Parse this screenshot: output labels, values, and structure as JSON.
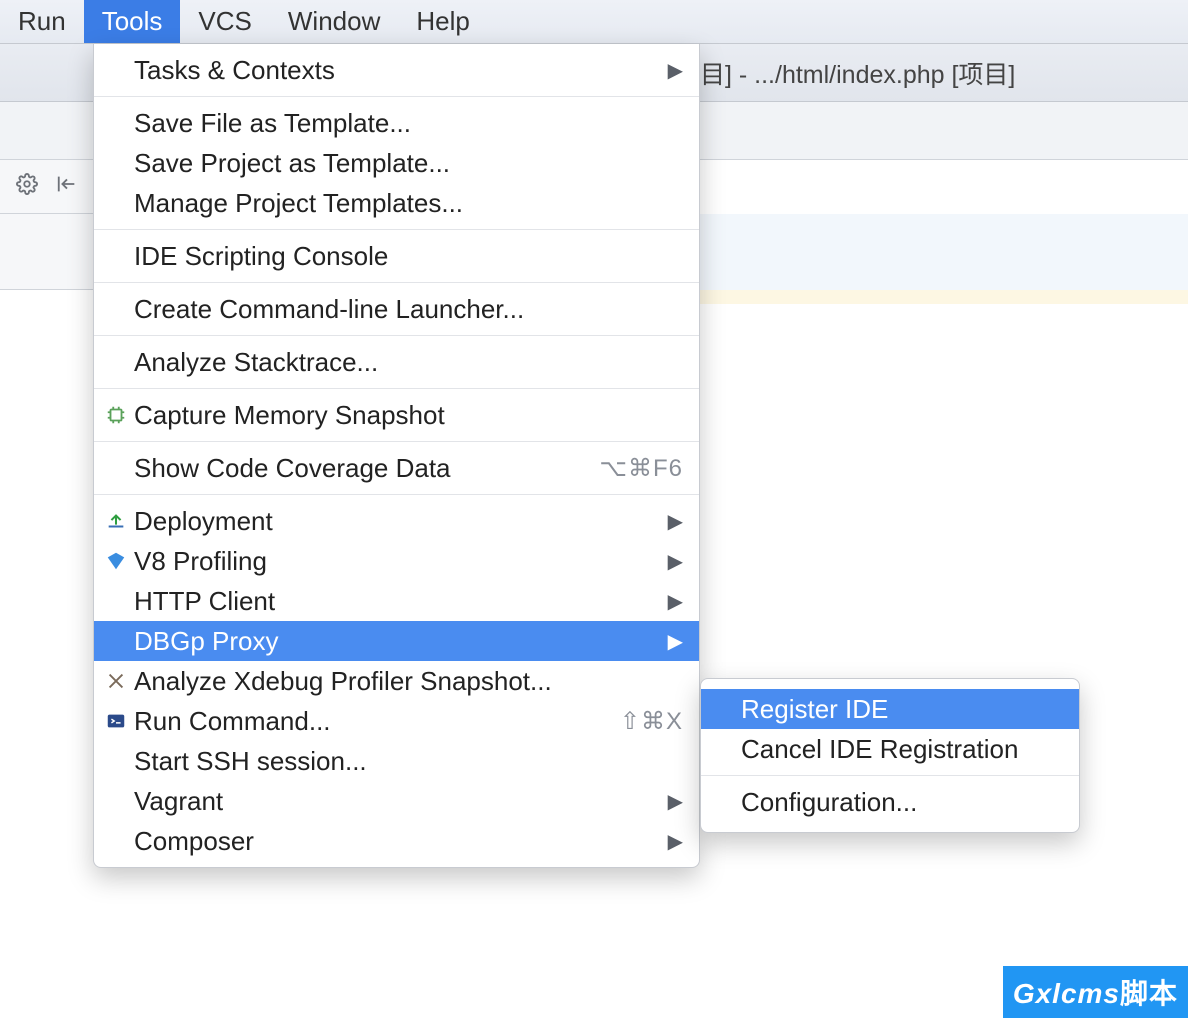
{
  "menubar": {
    "items": [
      {
        "label": "Run"
      },
      {
        "label": "Tools"
      },
      {
        "label": "VCS"
      },
      {
        "label": "Window"
      },
      {
        "label": "Help"
      }
    ],
    "active_index": 1
  },
  "title": "目] - .../html/index.php [项目]",
  "tools_menu": {
    "groups": [
      [
        {
          "label": "Tasks & Contexts",
          "submenu": true
        }
      ],
      [
        {
          "label": "Save File as Template..."
        },
        {
          "label": "Save Project as Template..."
        },
        {
          "label": "Manage Project Templates..."
        }
      ],
      [
        {
          "label": "IDE Scripting Console"
        }
      ],
      [
        {
          "label": "Create Command-line Launcher..."
        }
      ],
      [
        {
          "label": "Analyze Stacktrace..."
        }
      ],
      [
        {
          "label": "Capture Memory Snapshot",
          "icon": "chip-icon"
        }
      ],
      [
        {
          "label": "Show Code Coverage Data",
          "shortcut": "⌥⌘F6"
        }
      ],
      [
        {
          "label": "Deployment",
          "icon": "upload-icon",
          "submenu": true
        },
        {
          "label": "V8 Profiling",
          "icon": "v8-icon",
          "submenu": true
        },
        {
          "label": "HTTP Client",
          "submenu": true
        },
        {
          "label": "DBGp Proxy",
          "submenu": true,
          "highlighted": true
        },
        {
          "label": "Analyze Xdebug Profiler Snapshot...",
          "icon": "crossed-tools-icon"
        },
        {
          "label": "Run Command...",
          "icon": "terminal-icon",
          "shortcut": "⇧⌘X"
        },
        {
          "label": "Start SSH session..."
        },
        {
          "label": "Vagrant",
          "submenu": true
        },
        {
          "label": "Composer",
          "submenu": true
        }
      ]
    ]
  },
  "dbgp_submenu": {
    "groups": [
      [
        {
          "label": "Register IDE",
          "highlighted": true
        },
        {
          "label": "Cancel IDE Registration"
        }
      ],
      [
        {
          "label": "Configuration..."
        }
      ]
    ]
  },
  "watermark": {
    "brand": "Gxlcms",
    "suffix": "脚本"
  }
}
